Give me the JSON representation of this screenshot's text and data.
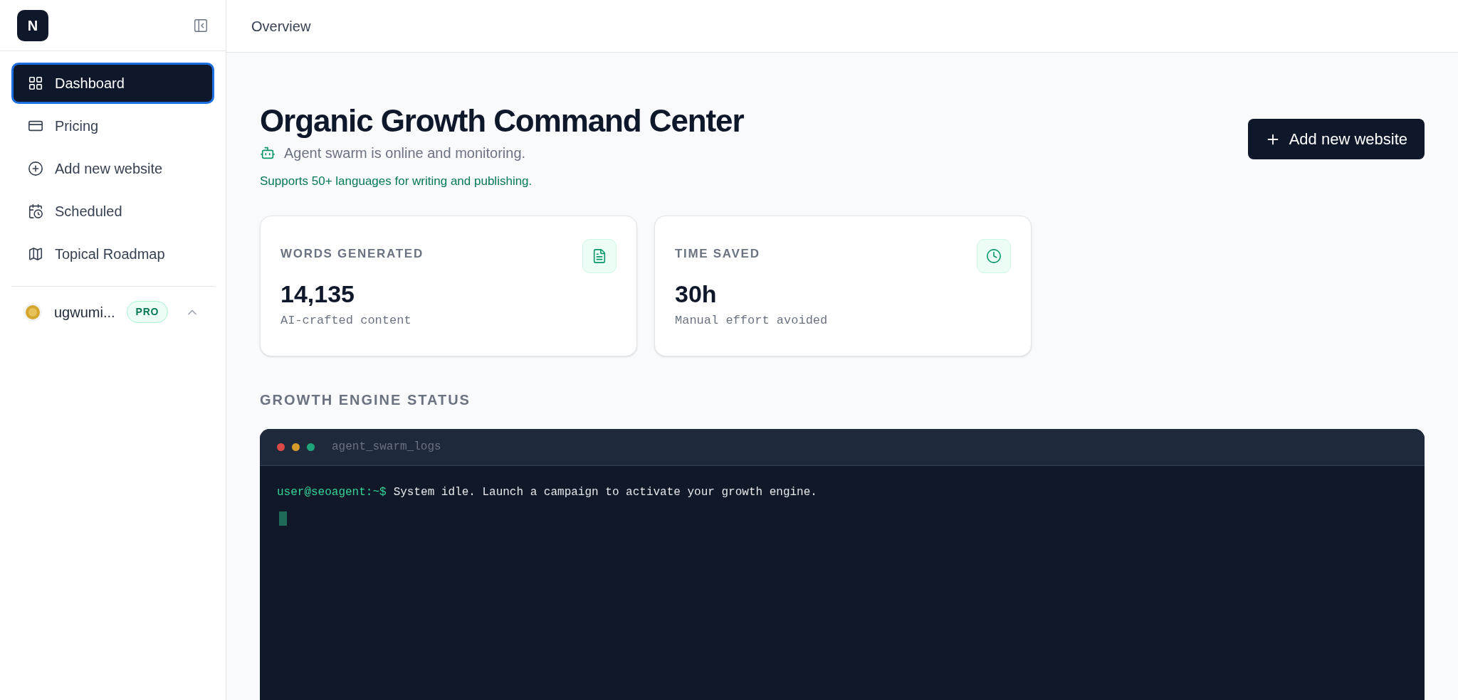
{
  "sidebar": {
    "logo": "N",
    "items": [
      {
        "label": "Dashboard",
        "selected": true
      },
      {
        "label": "Pricing",
        "selected": false
      },
      {
        "label": "Add new website",
        "selected": false
      },
      {
        "label": "Scheduled",
        "selected": false
      },
      {
        "label": "Topical Roadmap",
        "selected": false
      }
    ],
    "user": {
      "name": "ugwumi...",
      "badge": "PRO"
    }
  },
  "header": {
    "title": "Overview"
  },
  "page": {
    "title": "Organic Growth Command Center",
    "status": "Agent swarm is online and monitoring.",
    "note": "Supports 50+ languages for writing and publishing.",
    "button": "Add new website"
  },
  "stats": [
    {
      "label": "WORDS GENERATED",
      "value": "14,135",
      "caption": "AI-crafted content"
    },
    {
      "label": "TIME SAVED",
      "value": "30h",
      "caption": "Manual effort avoided"
    }
  ],
  "section_title": "GROWTH ENGINE STATUS",
  "terminal": {
    "title": "agent_swarm_logs",
    "prompt": "user@seoagent:~$",
    "message": "System idle. Launch a campaign to activate your growth engine."
  }
}
